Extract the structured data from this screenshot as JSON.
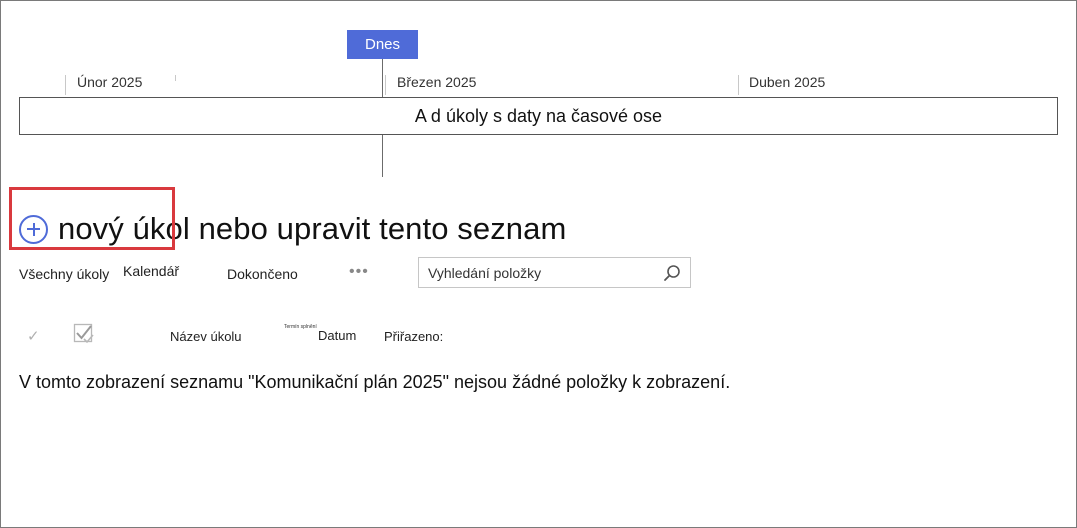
{
  "timeline": {
    "today_label": "Dnes",
    "months": [
      "Únor 2025",
      "Březen 2025",
      "Duben 2025"
    ],
    "bar_text": "A d úkoly s daty na časové ose"
  },
  "new_item": {
    "label": "nový úkol nebo upravit tento seznam",
    "icon": "plus-circle-icon"
  },
  "views": {
    "all_tasks": "Všechny úkoly",
    "calendar": "Kalendář",
    "completed": "Dokončeno",
    "more": "•••"
  },
  "search": {
    "placeholder": "Vyhledání položky"
  },
  "columns": {
    "check": "✓",
    "task_name": "Název úkolu",
    "due_tiny": "Termín splnění",
    "date": "Datum",
    "assigned": "Přiřazeno:"
  },
  "empty_message": "V tomto zobrazení seznamu \"Komunikační plán 2025\" nejsou žádné položky k zobrazení.",
  "colors": {
    "accent": "#4f6bd8",
    "highlight": "#d9393e"
  }
}
